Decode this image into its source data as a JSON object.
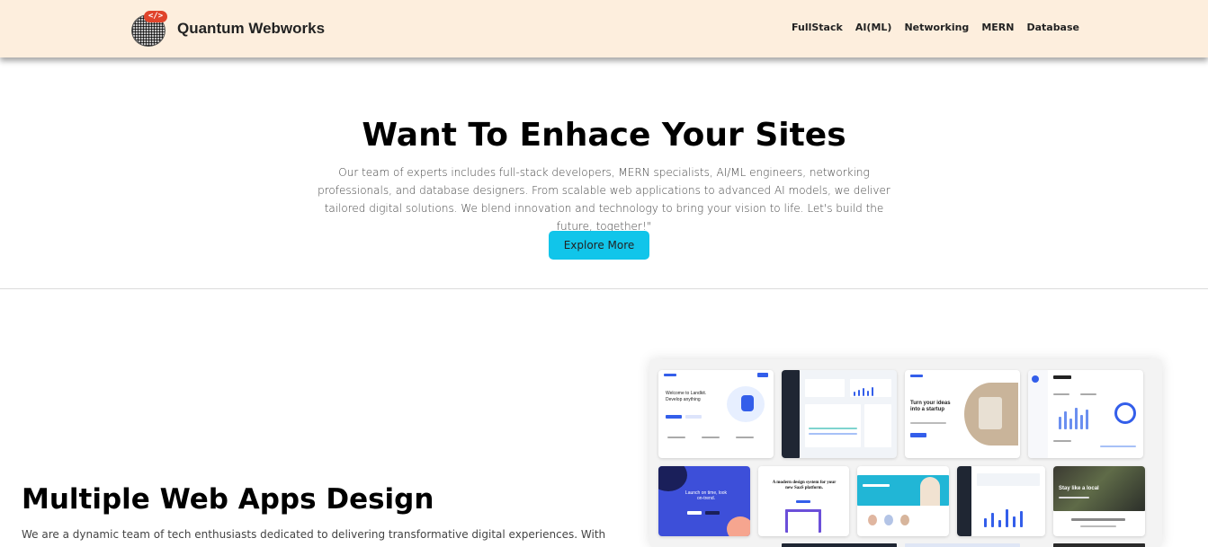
{
  "brand": {
    "name": "Quantum Webworks",
    "logo_tag": "</>"
  },
  "nav": [
    "FullStack",
    "AI(ML)",
    "Networking",
    "MERN",
    "Database"
  ],
  "hero": {
    "title": "Want To Enhace Your Sites",
    "description": "Our team of experts includes full-stack developers, MERN specialists, AI/ML engineers, networking professionals, and database designers. From scalable web applications to advanced AI models, we deliver tailored digital solutions. We blend innovation and technology to bring your vision to life. Let's build the future, together!\"",
    "button_label": "Explore More"
  },
  "section": {
    "title": "Multiple Web Apps Design",
    "description": "We are a dynamic team of tech enthusiasts dedicated to delivering transformative digital experiences. With"
  },
  "mockups": {
    "tile1_heading": "Welcome to Landkit.",
    "tile1_sub": "Develop anything",
    "tile3_heading": "Turn your ideas into a startup",
    "tile6_heading": "Launch on time, look on-trend.",
    "tile7_heading": "A modern design system for your new SaaS platform.",
    "tile10_heading": "Stay like a local"
  },
  "colors": {
    "nav_bg": "#fdeedd",
    "button_bg": "#11c5ea",
    "accent_blue": "#335eea"
  }
}
